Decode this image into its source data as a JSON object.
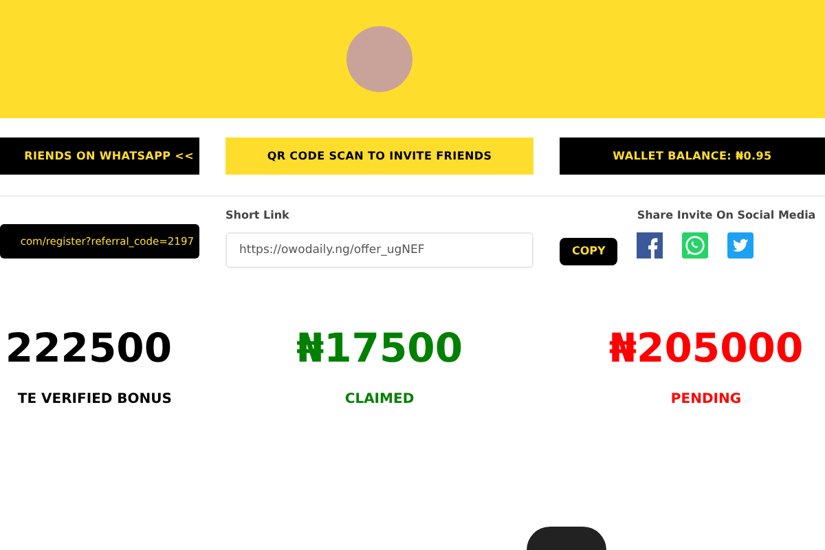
{
  "buttons": [
    {
      "label": "RIENDS ON WHATSAPP <<",
      "kind": "dark"
    },
    {
      "label": "QR CODE SCAN TO INVITE FRIENDS",
      "kind": "accent"
    },
    {
      "label": "WALLET BALANCE: ₦0.95",
      "kind": "dark"
    }
  ],
  "referral_link": {
    "value": "com/register?referral_code=2197"
  },
  "short_link": {
    "label": "Short Link",
    "value": "https://owodaily.ng/offer_ugNEF"
  },
  "copy_button": "COPY",
  "share": {
    "label": "Share Invite On Social Media"
  },
  "stats": [
    {
      "amount": "222500",
      "label": "TE VERIFIED BONUS",
      "color": "#000000"
    },
    {
      "amount": "₦17500",
      "label": "CLAIMED",
      "color": "#008000"
    },
    {
      "amount": "₦205000",
      "label": "PENDING",
      "color": "#ff0000"
    }
  ]
}
